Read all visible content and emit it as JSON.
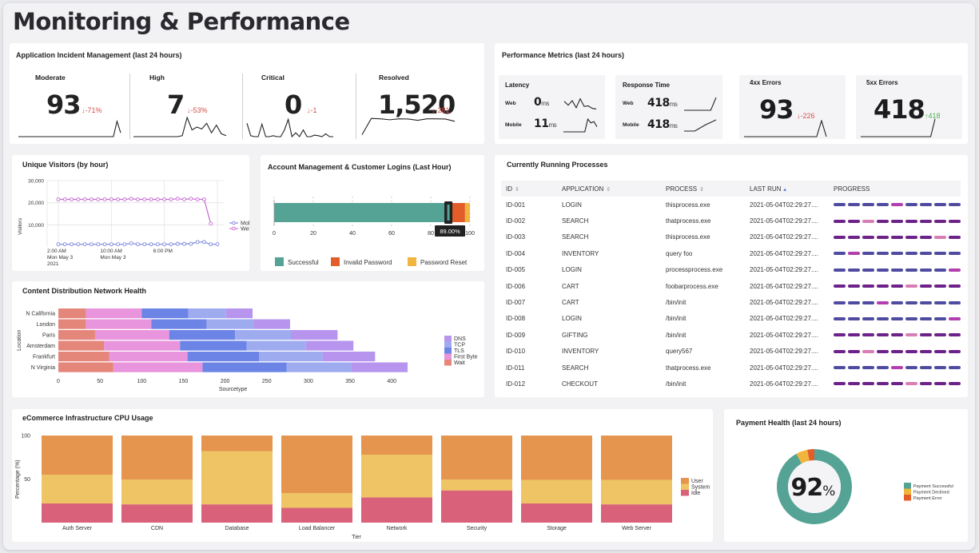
{
  "page": {
    "title": "Monitoring & Performance"
  },
  "incident": {
    "title": "Application Incident Management (last 24 hours)",
    "cells": [
      {
        "label": "Moderate",
        "value": "93",
        "delta": "↓-71%",
        "trend": [
          0,
          0,
          0,
          0,
          0,
          0,
          0,
          0,
          0,
          0,
          0,
          0,
          0,
          0,
          0,
          0,
          0,
          0,
          0,
          0,
          0,
          0,
          0,
          0,
          0,
          0,
          0,
          0.8,
          0.2
        ]
      },
      {
        "label": "High",
        "value": "7",
        "delta": "↓-53%",
        "trend": [
          0,
          0,
          0,
          0,
          0,
          0,
          0,
          0,
          0,
          0,
          0.05,
          1,
          0.35,
          0.5,
          0.4,
          0.7,
          0.2,
          0.6,
          0.15,
          0.05
        ]
      },
      {
        "label": "Critical",
        "value": "0",
        "delta": "↓-1",
        "trend": [
          0.7,
          0.05,
          0,
          0,
          0.65,
          0,
          0,
          0.05,
          0,
          0,
          0.35,
          0.9,
          0,
          0.2,
          0,
          0.35,
          0,
          0,
          0.08,
          0.05,
          0,
          0.15,
          0,
          0
        ]
      },
      {
        "label": "Resolved",
        "value": "1,520",
        "delta": "↓-281",
        "trend": [
          0.1,
          0.95,
          0.93,
          0.88,
          0.93,
          0.92,
          0.85,
          0.93,
          0.93,
          0.92,
          0.8
        ]
      }
    ]
  },
  "perf": {
    "title": "Performance Metrics (last 24 hours)",
    "latency": {
      "label": "Latency",
      "rows": [
        {
          "label": "Web",
          "value": "0",
          "unit": "ms",
          "trend": [
            0.7,
            0.4,
            0.75,
            0.2,
            0.9,
            0.3,
            0.35,
            0.15,
            0.1
          ]
        },
        {
          "label": "Mobile",
          "value": "11",
          "unit": "ms",
          "trend": [
            0,
            0,
            0,
            0,
            0,
            0,
            0,
            0,
            1,
            0.7,
            0.8,
            0.4
          ]
        }
      ]
    },
    "response": {
      "label": "Response Time",
      "rows": [
        {
          "label": "Web",
          "value": "418",
          "unit": "ms",
          "trend": [
            0,
            0,
            0,
            0,
            0,
            0,
            1
          ]
        },
        {
          "label": "Mobile",
          "value": "418",
          "unit": "ms",
          "trend": [
            0,
            0,
            0.55,
            1
          ]
        }
      ]
    },
    "errors4xx": {
      "label": "4xx Errors",
      "value": "93",
      "delta": "↓-226",
      "trend": [
        0,
        0,
        0,
        0,
        0,
        0,
        0,
        0,
        0,
        0,
        0,
        0,
        0,
        0,
        0,
        0,
        1,
        0
      ]
    },
    "errors5xx": {
      "label": "5xx Errors",
      "value": "418",
      "delta": "↑418",
      "trend": [
        0,
        0,
        0,
        0,
        0,
        0,
        0,
        0,
        0,
        0,
        0,
        0,
        0,
        0,
        0,
        0,
        0,
        1
      ]
    }
  },
  "visitors": {
    "title": "Unique Visitors (by hour)",
    "chart_data": {
      "type": "line",
      "title": "Unique Visitors (by hour)",
      "ylabel": "Visitors",
      "xlabel": "",
      "ylim": [
        0,
        30000
      ],
      "yticks": [
        "30,000",
        "20,000",
        "10,000"
      ],
      "xticks": [
        {
          "line1": "2:00 AM",
          "line2": "Mon May 3",
          "line3": "2021",
          "index": 0
        },
        {
          "line1": "10:00 AM",
          "line2": "Mon May 3",
          "line3": "",
          "index": 8
        },
        {
          "line1": "6:00 PM",
          "line2": "",
          "line3": "",
          "index": 16
        }
      ],
      "series": [
        {
          "name": "Mobile",
          "color": "#7b86d8",
          "values": [
            1200,
            1200,
            1200,
            1200,
            1200,
            1200,
            1200,
            1200,
            1200,
            1200,
            1200,
            1600,
            1200,
            1200,
            1200,
            1200,
            1200,
            1200,
            1400,
            1400,
            1400,
            2200,
            2200,
            1200,
            1200
          ]
        },
        {
          "name": "Web",
          "color": "#c56ad2",
          "values": [
            21500,
            21500,
            21500,
            21500,
            21500,
            21500,
            21500,
            21500,
            21500,
            21500,
            21500,
            21800,
            21500,
            21500,
            21500,
            21500,
            21500,
            21500,
            21800,
            21500,
            21800,
            21500,
            21500,
            10500
          ]
        }
      ]
    }
  },
  "logins": {
    "title": "Account Management & Customer Logins (Last Hour)",
    "tooltip": "89.00%",
    "chart_data": {
      "type": "bar",
      "orientation": "horizontal-stacked",
      "xlim": [
        0,
        100
      ],
      "xticks": [
        "0",
        "20",
        "40",
        "60",
        "80",
        "100"
      ],
      "series": [
        {
          "name": "Successful",
          "color": "#55a395",
          "value": 89
        },
        {
          "name": "Invalid Password",
          "color": "#e35d2b",
          "value": 8.5
        },
        {
          "name": "Password Reset",
          "color": "#f0b53c",
          "value": 2.5
        }
      ]
    }
  },
  "cdn": {
    "title": "Content Distribution Network Health",
    "chart_data": {
      "type": "bar",
      "orientation": "horizontal-stacked",
      "xlabel": "Sourcetype",
      "ylabel": "Location",
      "xlim": [
        0,
        420
      ],
      "xticks": [
        "0",
        "50",
        "100",
        "150",
        "200",
        "250",
        "300",
        "350",
        "400"
      ],
      "categories": [
        "N California",
        "London",
        "Paris",
        "Amsterdam",
        "Frankfurt",
        "N Virginia"
      ],
      "series": [
        {
          "name": "Wait",
          "color": "#e5867a",
          "values": [
            33,
            33,
            44,
            55,
            61,
            66
          ]
        },
        {
          "name": "First Byte",
          "color": "#e895dd",
          "values": [
            67,
            78.5,
            89,
            91,
            94,
            107
          ]
        },
        {
          "name": "TLS",
          "color": "#6b84e6",
          "values": [
            56,
            66.5,
            79,
            80,
            86,
            101
          ]
        },
        {
          "name": "TCP",
          "color": "#9eabef",
          "values": [
            45,
            56,
            67,
            71,
            76,
            77
          ]
        },
        {
          "name": "DNS",
          "color": "#b795ee",
          "values": [
            32,
            44,
            56,
            57,
            63,
            68
          ]
        }
      ],
      "legend_order": [
        "DNS",
        "TCP",
        "TLS",
        "First Byte",
        "Wait"
      ],
      "legend_position": "right"
    }
  },
  "processes": {
    "title": "Currently Running Processes",
    "columns": [
      "ID",
      "APPLICATION",
      "PROCESS",
      "LAST RUN",
      "PROGRESS"
    ],
    "colors": {
      "a": "#4f4ba0",
      "b": "#b23fae",
      "c": "#6d2289",
      "d": "#d97db5"
    },
    "rows": [
      {
        "id": "ID-001",
        "app": "LOGIN",
        "process": "thisprocess.exe",
        "last_run": "2021-05-04T02:29:27....",
        "progress": "aaaabaaaa"
      },
      {
        "id": "ID-002",
        "app": "SEARCH",
        "process": "thatprocess.exe",
        "last_run": "2021-05-04T02:29:27....",
        "progress": "ccdcccccc"
      },
      {
        "id": "ID-003",
        "app": "SEARCH",
        "process": "thisprocess.exe",
        "last_run": "2021-05-04T02:29:27....",
        "progress": "cccccccdc"
      },
      {
        "id": "ID-004",
        "app": "INVENTORY",
        "process": "query foo",
        "last_run": "2021-05-04T02:29:27....",
        "progress": "abaaaaaaa"
      },
      {
        "id": "ID-005",
        "app": "LOGIN",
        "process": "processprocess.exe",
        "last_run": "2021-05-04T02:29:27....",
        "progress": "aaaaaaaab"
      },
      {
        "id": "ID-006",
        "app": "CART",
        "process": "foobarprocess.exe",
        "last_run": "2021-05-04T02:29:27....",
        "progress": "cccccdccc"
      },
      {
        "id": "ID-007",
        "app": "CART",
        "process": "/bin/init",
        "last_run": "2021-05-04T02:29:27....",
        "progress": "aaabaaaaa"
      },
      {
        "id": "ID-008",
        "app": "LOGIN",
        "process": "/bin/init",
        "last_run": "2021-05-04T02:29:27....",
        "progress": "aaaaaaaab"
      },
      {
        "id": "ID-009",
        "app": "GIFTING",
        "process": "/bin/init",
        "last_run": "2021-05-04T02:29:27....",
        "progress": "cccccdccc"
      },
      {
        "id": "ID-010",
        "app": "INVENTORY",
        "process": "query567",
        "last_run": "2021-05-04T02:29:27....",
        "progress": "ccdcccccc"
      },
      {
        "id": "ID-011",
        "app": "SEARCH",
        "process": "thatprocess.exe",
        "last_run": "2021-05-04T02:29:27....",
        "progress": "aaaabaaaa"
      },
      {
        "id": "ID-012",
        "app": "CHECKOUT",
        "process": "/bin/init",
        "last_run": "2021-05-04T02:29:27....",
        "progress": "cccccdccc"
      }
    ]
  },
  "cpu": {
    "title": "eCommerce Infrastructure CPU Usage",
    "chart_data": {
      "type": "bar",
      "orientation": "vertical-stacked-100",
      "xlabel": "Tier",
      "ylabel": "Percentage (%)",
      "ylim": [
        0,
        100
      ],
      "yticks": [
        "100",
        "50"
      ],
      "categories": [
        "Auth Server",
        "CDN",
        "Database",
        "Load Balancer",
        "Network",
        "Security",
        "Storage",
        "Web Server"
      ],
      "series": [
        {
          "name": "Idle",
          "color": "#d9627a",
          "values": [
            22,
            21,
            21,
            17,
            29,
            37,
            22,
            21
          ]
        },
        {
          "name": "System",
          "color": "#efc464",
          "values": [
            33,
            28.5,
            61,
            17,
            49,
            12.5,
            27,
            28
          ]
        },
        {
          "name": "User",
          "color": "#e5954d",
          "values": [
            45,
            50.5,
            18,
            66,
            22,
            50.5,
            51,
            51
          ]
        }
      ],
      "legend_order": [
        "User",
        "System",
        "Idle"
      ],
      "legend_position": "right"
    }
  },
  "payment": {
    "title": "Payment Health (last 24 hours)",
    "center_value": "92",
    "center_unit": "%",
    "chart_data": {
      "type": "pie",
      "style": "donut",
      "series": [
        {
          "name": "Payment Successful",
          "color": "#55a395",
          "value": 92
        },
        {
          "name": "Payment Declined",
          "color": "#f0b53c",
          "value": 5
        },
        {
          "name": "Payment Error",
          "color": "#e35d2b",
          "value": 3
        }
      ]
    }
  }
}
